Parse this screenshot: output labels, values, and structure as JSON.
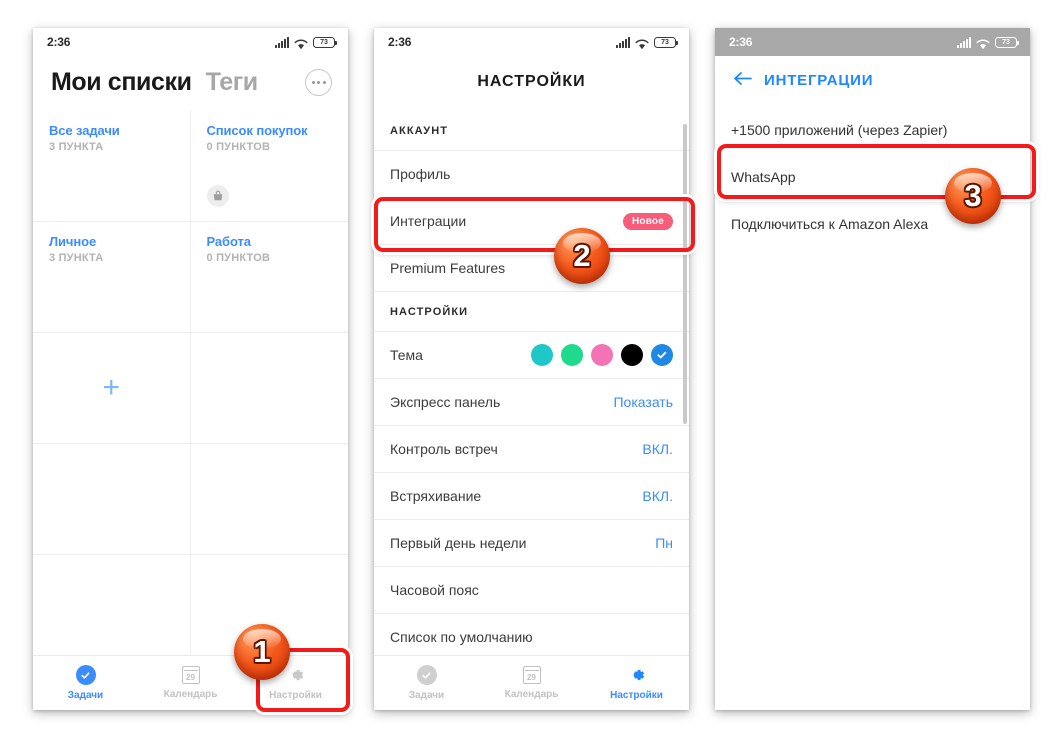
{
  "statusbar": {
    "time": "2:36",
    "battery": "73"
  },
  "panel1": {
    "title": "Мои списки",
    "tab": "Теги",
    "more_icon": "ellipsis-icon",
    "cards": [
      {
        "title": "Все задачи",
        "sub": "3 ПУНКТА",
        "icon": ""
      },
      {
        "title": "Список покупок",
        "sub": "0 ПУНКТОВ",
        "icon": "basket-icon"
      },
      {
        "title": "Личное",
        "sub": "3 ПУНКТА",
        "icon": ""
      },
      {
        "title": "Работа",
        "sub": "0 ПУНКТОВ",
        "icon": ""
      }
    ],
    "add_label": "+",
    "tabbar": [
      {
        "label": "Задачи",
        "icon": "check-circle-icon",
        "active": true
      },
      {
        "label": "Календарь",
        "icon": "calendar-icon",
        "day": "29",
        "active": false
      },
      {
        "label": "Настройки",
        "icon": "gear-icon",
        "active": false
      }
    ]
  },
  "panel2": {
    "title": "НАСТРОЙКИ",
    "section_account": "АККАУНТ",
    "section_settings": "НАСТРОЙКИ",
    "rows_account": [
      {
        "label": "Профиль",
        "value": "",
        "badge": ""
      },
      {
        "label": "Интеграции",
        "value": "",
        "badge": "Новое"
      },
      {
        "label": "Premium Features",
        "value": "",
        "badge": ""
      }
    ],
    "theme_label": "Тема",
    "theme_colors": [
      "#1ec8c8",
      "#1fd98d",
      "#f472b6",
      "#000000",
      "#1e88e5"
    ],
    "theme_selected_index": 4,
    "rows_settings": [
      {
        "label": "Экспресс панель",
        "value": "Показать"
      },
      {
        "label": "Контроль встреч",
        "value": "ВКЛ."
      },
      {
        "label": "Встряхивание",
        "value": "ВКЛ."
      },
      {
        "label": "Первый день недели",
        "value": "Пн"
      },
      {
        "label": "Часовой пояс",
        "value": ""
      },
      {
        "label": "Список по умолчанию",
        "value": ""
      }
    ],
    "tabbar": [
      {
        "label": "Задачи",
        "icon": "check-circle-icon",
        "active": false
      },
      {
        "label": "Календарь",
        "icon": "calendar-icon",
        "day": "29",
        "active": false
      },
      {
        "label": "Настройки",
        "icon": "gear-icon",
        "active": true
      }
    ]
  },
  "panel3": {
    "back_icon": "arrow-left-icon",
    "title": "ИНТЕГРАЦИИ",
    "rows": [
      {
        "label": "+1500 приложений (через Zapier)"
      },
      {
        "label": "WhatsApp"
      },
      {
        "label": "Подключиться к Amazon Alexa"
      }
    ]
  },
  "steps": {
    "one": "1",
    "two": "2",
    "three": "3"
  },
  "colors": {
    "accent_blue": "#3b8cff",
    "link_blue": "#1e88ff",
    "badge_pink": "#f75c78",
    "highlight_red": "#f21a1a"
  }
}
